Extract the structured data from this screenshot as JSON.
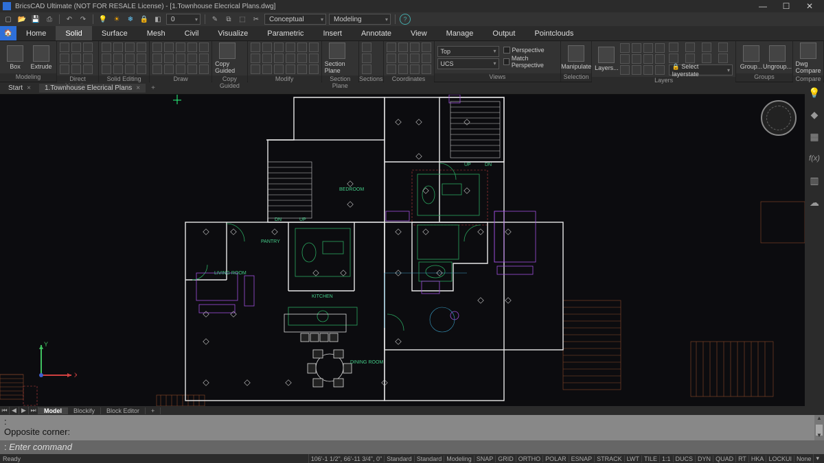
{
  "title": "BricsCAD Ultimate (NOT FOR RESALE License) - [1.Townhouse Elecrical Plans.dwg]",
  "qat": {
    "field_value": "0",
    "visual_style": "Conceptual",
    "workspace": "Modeling"
  },
  "menu": [
    "Home",
    "Solid",
    "Surface",
    "Mesh",
    "Civil",
    "Visualize",
    "Parametric",
    "Insert",
    "Annotate",
    "View",
    "Manage",
    "Output",
    "Pointclouds"
  ],
  "menu_active": "Solid",
  "ribbon": {
    "panels": [
      {
        "label": "Modeling",
        "big": [
          {
            "name": "Box"
          },
          {
            "name": "Extrude"
          }
        ],
        "grid_cols": 0
      },
      {
        "label": "Direct Modeling",
        "grid_cols": 3
      },
      {
        "label": "Solid Editing",
        "grid_cols": 4
      },
      {
        "label": "Draw",
        "grid_cols": 5
      },
      {
        "label": "Copy Guided",
        "big": [
          {
            "name": "Copy Guided"
          }
        ],
        "grid_cols": 0
      },
      {
        "label": "Modify",
        "grid_cols": 6
      },
      {
        "label": "Section Plane",
        "big": [
          {
            "name": "Section Plane"
          }
        ],
        "grid_cols": 0
      },
      {
        "label": "Sections",
        "grid_cols": 1
      },
      {
        "label": "Coordinates",
        "grid_cols": 4
      },
      {
        "label": "Views",
        "view_dd": "Top",
        "ucs_dd": "UCS",
        "chk1": "Perspective",
        "chk2": "Match Perspective"
      },
      {
        "label": "Selection",
        "big": [
          {
            "name": "Manipulate"
          }
        ],
        "grid_cols": 0
      },
      {
        "label": "Layers",
        "big": [
          {
            "name": "Layers..."
          }
        ],
        "layerstate": "Select layerstate",
        "grid_cols": 4
      },
      {
        "label": "Groups",
        "big": [
          {
            "name": "Group..."
          },
          {
            "name": "Ungroup..."
          }
        ],
        "grid_cols": 0
      },
      {
        "label": "Compare",
        "big": [
          {
            "name": "Dwg Compare"
          }
        ],
        "grid_cols": 0
      }
    ]
  },
  "doctabs": {
    "start": "Start",
    "file": "1.Townhouse Elecrical Plans"
  },
  "layout_tabs": [
    "Model",
    "Blockify",
    "Block Editor"
  ],
  "layout_active": "Model",
  "command": {
    "line1": ":",
    "line2": "Opposite corner:",
    "prompt_prefix": ": ",
    "prompt": "Enter command"
  },
  "status": {
    "ready": "Ready",
    "coords": "106'-1 1/2\", 66'-11 3/4\", 0\"",
    "cells": [
      "Standard",
      "Standard",
      "Modeling",
      "SNAP",
      "GRID",
      "ORTHO",
      "POLAR",
      "ESNAP",
      "STRACK",
      "LWT",
      "TILE",
      "1:1",
      "DUCS",
      "DYN",
      "QUAD",
      "RT",
      "HKA",
      "LOCKUI",
      "None"
    ]
  },
  "rooms": {
    "bedroom": "BEDROOM",
    "kitchen": "KITCHEN",
    "living": "LIVING ROOM",
    "dining": "DINING ROOM",
    "pantry": "PANTRY",
    "up": "UP",
    "dn": "DN"
  },
  "ucs_axes": {
    "x": "X",
    "y": "Y"
  }
}
